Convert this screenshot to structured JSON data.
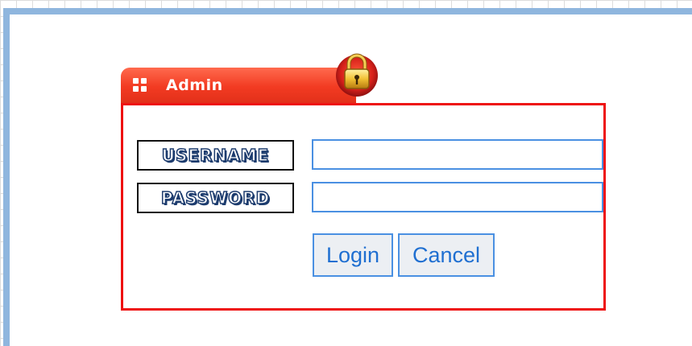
{
  "dialog": {
    "title": "Admin",
    "username_label": "USERNAME",
    "password_label": "PASSWORD",
    "username_value": "",
    "password_value": "",
    "login_label": "Login",
    "cancel_label": "Cancel"
  },
  "colors": {
    "frame": "#8fb6de",
    "tab": "#f23b22",
    "border": "#ee1111",
    "input_border": "#4a90e2",
    "button_text": "#1f6fd1"
  }
}
